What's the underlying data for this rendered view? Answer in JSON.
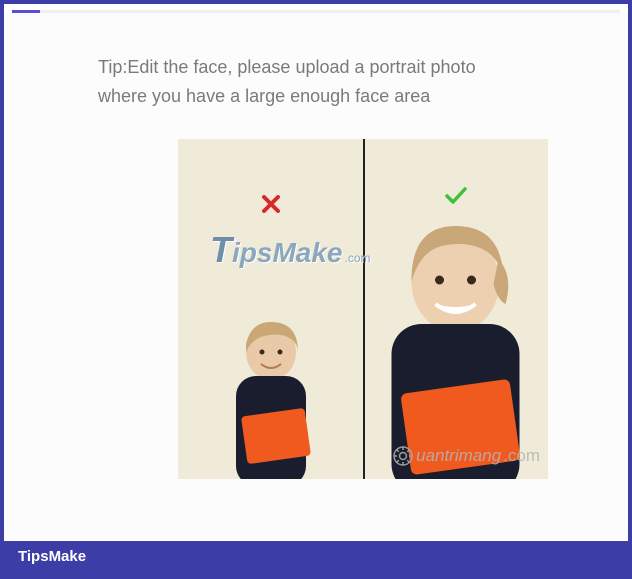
{
  "tip_text": "Tip:Edit the face, please upload a portrait photo where you have a large enough face area",
  "marks": {
    "wrong": "✕",
    "correct": "✓"
  },
  "watermark_main": "TipsMake",
  "watermark_main_suffix": ".com",
  "watermark_secondary": "uantrimang",
  "footer_label": "TipsMake"
}
